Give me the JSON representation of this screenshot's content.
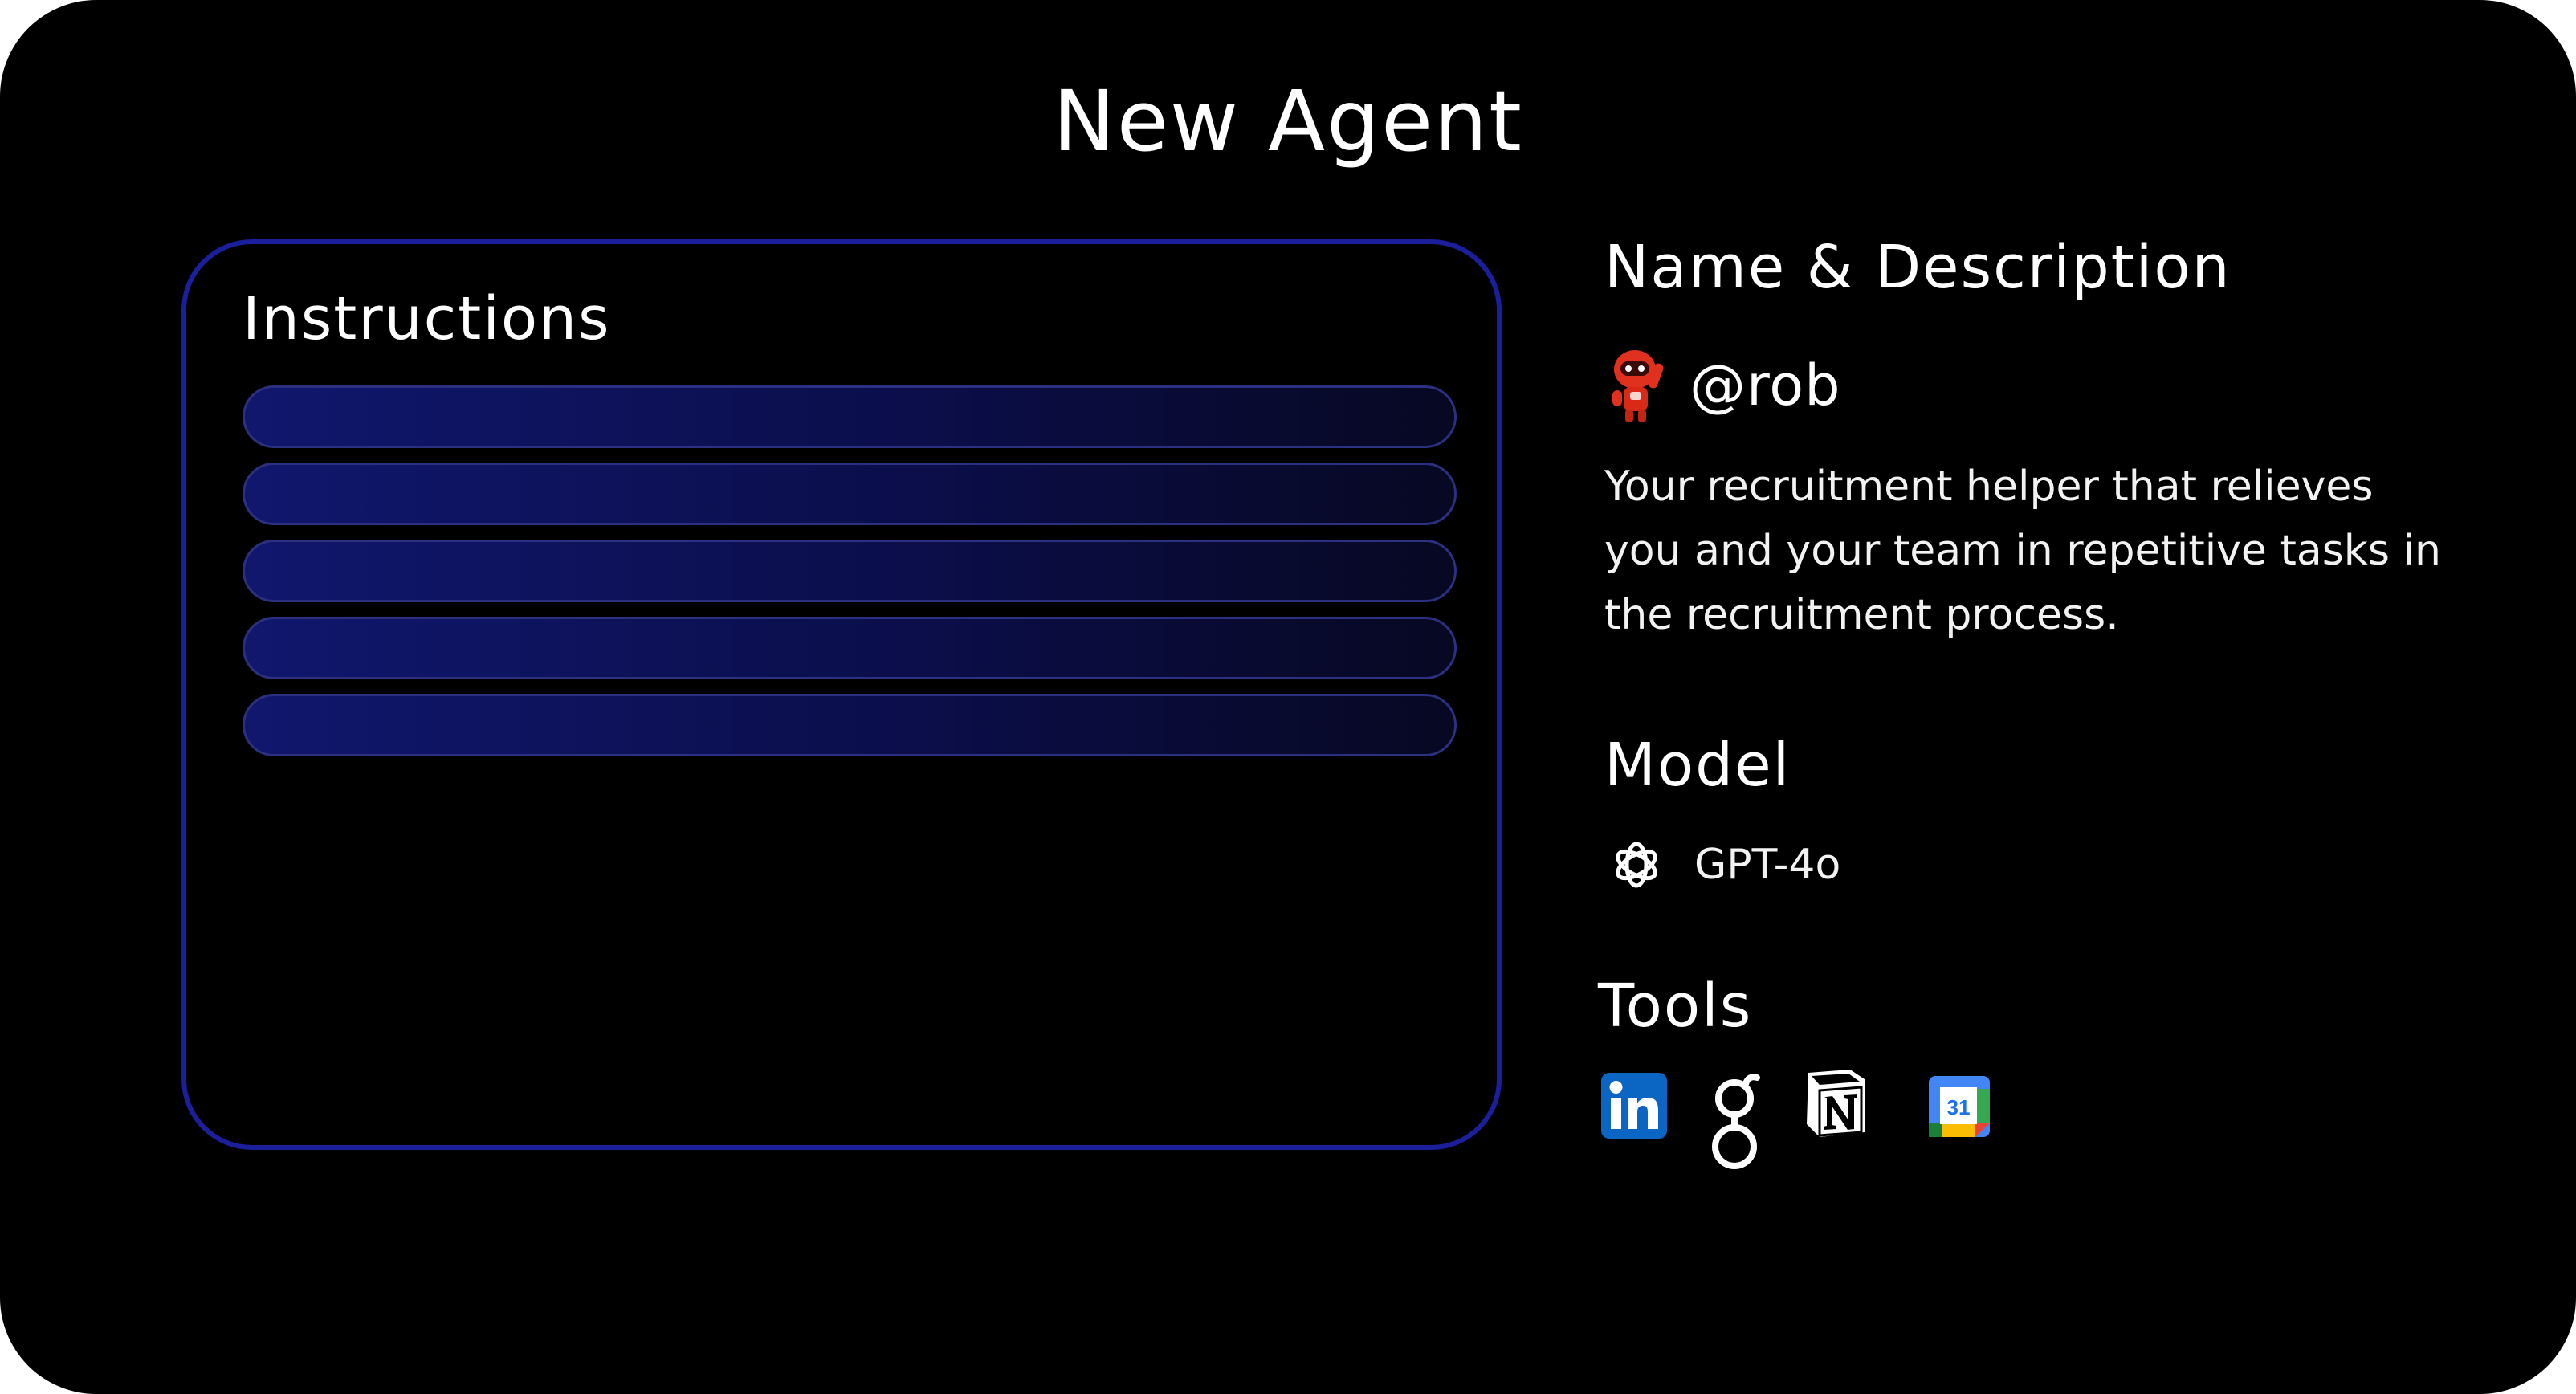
{
  "page_title": "New Agent",
  "instructions": {
    "title": "Instructions",
    "lines_count": 5
  },
  "name_description": {
    "section_title": "Name & Description",
    "avatar_icon": "robot-avatar-icon",
    "handle": "@rob",
    "description": "Your recruitment helper that relieves you and your team in repetitive tasks in the recruitment process."
  },
  "model": {
    "section_title": "Model",
    "icon": "openai-icon",
    "name": "GPT-4o"
  },
  "tools": {
    "section_title": "Tools",
    "items": [
      {
        "icon": "linkedin-icon"
      },
      {
        "icon": "greenhouse-icon"
      },
      {
        "icon": "notion-icon"
      },
      {
        "icon": "google-calendar-icon",
        "day": "31"
      }
    ]
  },
  "colors": {
    "background": "#000000",
    "card_border": "#1c1f9c",
    "line_fill_start": "#10176d",
    "line_fill_end": "#070822",
    "text": "#ffffff",
    "linkedin_blue": "#0a66c2",
    "robot_red": "#e0301e"
  }
}
